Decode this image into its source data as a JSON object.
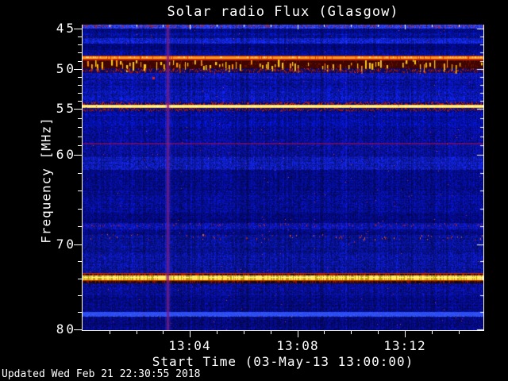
{
  "title": "Solar radio Flux (Glasgow)",
  "updated": "Updated Wed Feb 21 22:30:55 2018",
  "colors": {
    "background": "#000000",
    "text": "#ffffff",
    "spectrogram_base_blue": "#0a14a0",
    "carrier_orange": "#ff8e12",
    "carrier_yellow": "#ffe558",
    "rfi_red": "#c02000",
    "bright_blue_band": "#2b4cf0",
    "vertical_event_purple": "#a93cd2"
  },
  "chart_data": {
    "type": "heatmap",
    "title": "Solar radio Flux (Glasgow)",
    "xlabel": "Start Time (03-May-13 13:00:00)",
    "ylabel": "Frequency [MHz]",
    "x_start": "13:00:00",
    "x_span_minutes": 14.93,
    "x_major_ticks": [
      {
        "label": "13:04",
        "minute": 4
      },
      {
        "label": "13:08",
        "minute": 8
      },
      {
        "label": "13:12",
        "minute": 12
      }
    ],
    "x_minor_tick_minutes": [
      1,
      2,
      3,
      5,
      6,
      7,
      9,
      10,
      11,
      13,
      14
    ],
    "y_axis_direction": "frequency increases downward",
    "y_ticks": [
      {
        "label": "45",
        "freq_mhz": 45,
        "frac": 0.013
      },
      {
        "label": "50",
        "freq_mhz": 50,
        "frac": 0.145
      },
      {
        "label": "55",
        "freq_mhz": 55,
        "frac": 0.275
      },
      {
        "label": "60",
        "freq_mhz": 60,
        "frac": 0.426
      },
      {
        "label": "70",
        "freq_mhz": 70,
        "frac": 0.719
      },
      {
        "label": "80",
        "freq_mhz": 80,
        "frac": 0.997
      }
    ],
    "y_minor_fracs": [
      0.0394,
      0.0658,
      0.0922,
      0.1186,
      0.171,
      0.197,
      0.223,
      0.249,
      0.3052,
      0.3354,
      0.3656,
      0.3958,
      0.4846,
      0.5432,
      0.6018,
      0.6604,
      0.7746,
      0.8302,
      0.8858,
      0.9414
    ],
    "grid": false,
    "legend": false,
    "colormap": "dark-blue background with red/orange/yellow intense RFI lines",
    "base_bands": [
      {
        "f": 0.0,
        "t": 0.011,
        "c": "#2a38e0"
      },
      {
        "f": 0.011,
        "t": 0.028,
        "c": "#000c85"
      },
      {
        "f": 0.028,
        "t": 0.044,
        "c": "#041093"
      },
      {
        "f": 0.044,
        "t": 0.062,
        "c": "#0f20c8"
      },
      {
        "f": 0.062,
        "t": 0.082,
        "c": "#000878"
      },
      {
        "f": 0.082,
        "t": 0.101,
        "c": "#020d8c"
      },
      {
        "f": 0.101,
        "t": 0.157,
        "c": "#10095e"
      },
      {
        "f": 0.157,
        "t": 0.176,
        "c": "#0a16ae"
      },
      {
        "f": 0.176,
        "t": 0.215,
        "c": "#0711a0"
      },
      {
        "f": 0.215,
        "t": 0.252,
        "c": "#0a17b2"
      },
      {
        "f": 0.252,
        "t": 0.281,
        "c": "#0a0a70"
      },
      {
        "f": 0.281,
        "t": 0.335,
        "c": "#040f9e"
      },
      {
        "f": 0.335,
        "t": 0.388,
        "c": "#060d92"
      },
      {
        "f": 0.388,
        "t": 0.432,
        "c": "#081098"
      },
      {
        "f": 0.432,
        "t": 0.475,
        "c": "#0d1aae"
      },
      {
        "f": 0.475,
        "t": 0.545,
        "c": "#040b85"
      },
      {
        "f": 0.545,
        "t": 0.618,
        "c": "#050d8e"
      },
      {
        "f": 0.618,
        "t": 0.649,
        "c": "#03097c"
      },
      {
        "f": 0.649,
        "t": 0.668,
        "c": "#0a14a8"
      },
      {
        "f": 0.668,
        "t": 0.686,
        "c": "#040b82"
      },
      {
        "f": 0.686,
        "t": 0.75,
        "c": "#071190"
      },
      {
        "f": 0.75,
        "t": 0.813,
        "c": "#091398"
      },
      {
        "f": 0.813,
        "t": 0.845,
        "c": "#1e0800"
      },
      {
        "f": 0.845,
        "t": 0.884,
        "c": "#070e8c"
      },
      {
        "f": 0.884,
        "t": 0.939,
        "c": "#040a80"
      },
      {
        "f": 0.939,
        "t": 0.954,
        "c": "#2b4cf0"
      },
      {
        "f": 0.954,
        "t": 1.0,
        "c": "#040979"
      }
    ],
    "features": [
      {
        "name": "top-edge-noise-row",
        "type": "top_speckle",
        "freq_mhz": 44.6,
        "f": 0.0,
        "t": 0.01,
        "color": "#b3221a",
        "prob": 0.28
      },
      {
        "name": "carrier-48.8mhz-orange-line",
        "type": "orange_line",
        "freq_mhz": 48.8,
        "f": 0.101,
        "t": 0.114,
        "colors": [
          "#b42000",
          "#ff8e12",
          "#ffb23a",
          "#c22800"
        ]
      },
      {
        "name": "rfi-band-49-50.5mhz-intermittent",
        "type": "dash_band",
        "freq_mhz": "49.2-50.5",
        "f": 0.114,
        "t": 0.143,
        "bg": "#3f0500",
        "dash": "#ffc818",
        "dash2": "#ff9010",
        "edge": "#c83008",
        "prob": 0.62
      },
      {
        "name": "rfi-50.8mhz-speckled-red-line",
        "type": "speckle_row",
        "freq_mhz": 50.8,
        "f": 0.143,
        "t": 0.157,
        "colors": [
          "#8c1300",
          "#b02408"
        ],
        "prob": 0.72
      },
      {
        "name": "isolated-red-dot",
        "type": "dot",
        "x_frac": 0.176,
        "y_frac": 0.174,
        "color": "#e02818"
      },
      {
        "name": "carrier-54.6mhz-yellow-line",
        "type": "yellow_carrier",
        "freq_mhz": 54.6,
        "red_top": [
          0.252,
          0.263
        ],
        "core": [
          0.263,
          0.274
        ],
        "red_bot": [
          0.274,
          0.281
        ],
        "core_colors": [
          "#ffd23e",
          "#fff1a0",
          "#ffcf30"
        ],
        "edge": "#bf1d00"
      },
      {
        "name": "faint-58.5mhz-line",
        "type": "tint_row",
        "freq_mhz": 58.5,
        "f": 0.388,
        "t": 0.393,
        "color": "rgba(165,15,75,0.55)"
      },
      {
        "name": "sparse-speckle-68.3mhz",
        "type": "speckle_row",
        "freq_mhz": 68.3,
        "f": 0.65,
        "t": 0.66,
        "colors": [
          "#8c2060",
          "#b02030",
          "#5a1a70"
        ],
        "prob": 0.2
      },
      {
        "name": "sparse-speckle-69.5mhz",
        "type": "speckle_row",
        "freq_mhz": 69.5,
        "f": 0.686,
        "t": 0.704,
        "colors": [
          "#d03020",
          "#e06020",
          "#902018"
        ],
        "prob": 0.13
      },
      {
        "name": "carrier-74.5mhz-yellow-band",
        "type": "yellow_dashed_carrier",
        "freq_mhz": 74.5,
        "red_top": [
          0.813,
          0.822
        ],
        "core": [
          0.822,
          0.837
        ],
        "red_bot": [
          0.837,
          0.845
        ],
        "core_colors": [
          "#ffe44e",
          "#bfa80e",
          "#fff3b0"
        ],
        "edge": "#c02000"
      },
      {
        "name": "bright-blue-band-78.6mhz",
        "type": "blue_band",
        "freq_mhz": 78.6,
        "f": 0.939,
        "t": 0.954,
        "color": "#2b4cf0",
        "hi": "#3b5cff"
      }
    ],
    "vertical_event": {
      "name": "vertical-purple-streak",
      "time": "~13:03:10",
      "x_frac": 0.212,
      "color": "rgba(175,60,210,0.55)",
      "halo": "rgba(120,80,220,0.18)",
      "mult": "rgba(200,30,110,0.5)"
    },
    "scattered_dots": {
      "count": 260,
      "colors": [
        "#c02030",
        "#a020a0",
        "#d04040"
      ]
    }
  }
}
